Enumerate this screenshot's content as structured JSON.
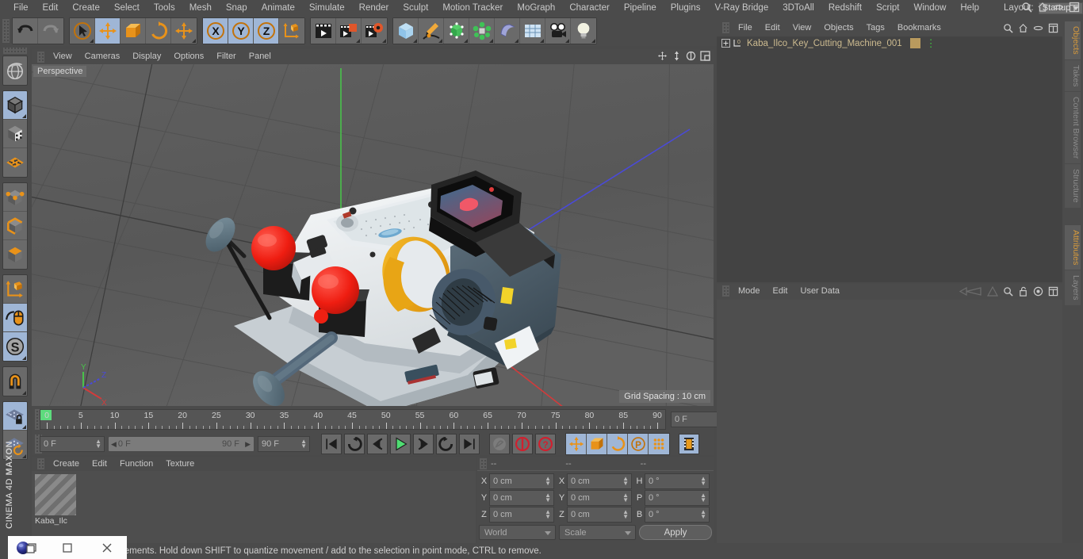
{
  "app": {
    "brand_top": "MAXON",
    "brand_bottom": "CINEMA 4D"
  },
  "menubar": {
    "items": [
      "File",
      "Edit",
      "Create",
      "Select",
      "Tools",
      "Mesh",
      "Snap",
      "Animate",
      "Simulate",
      "Render",
      "Sculpt",
      "Motion Tracker",
      "MoGraph",
      "Character",
      "Pipeline",
      "Plugins",
      "V-Ray Bridge",
      "3DToAll",
      "Redshift",
      "Script",
      "Window",
      "Help"
    ],
    "layout_label": "Layout:",
    "layout_value": "Startup",
    "icons": [
      "search-icon",
      "home-icon",
      "minimize-icon",
      "maximize-icon"
    ]
  },
  "toolbar": {
    "groups": [
      {
        "name": "history",
        "buttons": [
          {
            "icon": "undo-icon",
            "selected": false,
            "corner": false
          },
          {
            "icon": "redo-icon",
            "selected": false,
            "corner": false
          }
        ]
      },
      {
        "name": "tools",
        "buttons": [
          {
            "icon": "live-selection-icon",
            "selected": false,
            "corner": true
          },
          {
            "icon": "move-icon",
            "selected": true,
            "corner": false
          },
          {
            "icon": "scale-icon",
            "selected": false,
            "corner": false
          },
          {
            "icon": "rotate-icon",
            "selected": false,
            "corner": false
          },
          {
            "icon": "move-dup-icon",
            "selected": false,
            "corner": true
          }
        ]
      },
      {
        "name": "axis-locks",
        "buttons": [
          {
            "icon": "axis-x-icon",
            "selected": true,
            "corner": false
          },
          {
            "icon": "axis-y-icon",
            "selected": true,
            "corner": false
          },
          {
            "icon": "axis-z-icon",
            "selected": true,
            "corner": false
          },
          {
            "icon": "world-coordinate-icon",
            "selected": false,
            "corner": false
          }
        ]
      },
      {
        "name": "render",
        "buttons": [
          {
            "icon": "render-view-icon",
            "selected": false,
            "corner": false
          },
          {
            "icon": "render-region-icon",
            "selected": false,
            "corner": true
          },
          {
            "icon": "render-settings-icon",
            "selected": false,
            "corner": true
          }
        ]
      },
      {
        "name": "primitives",
        "buttons": [
          {
            "icon": "cube-primitive-icon",
            "selected": false,
            "corner": true
          },
          {
            "icon": "spline-pen-icon",
            "selected": false,
            "corner": true
          },
          {
            "icon": "array-generator-icon",
            "selected": false,
            "corner": true
          },
          {
            "icon": "mograph-cloner-icon",
            "selected": false,
            "corner": true
          },
          {
            "icon": "bend-deformer-icon",
            "selected": false,
            "corner": true
          },
          {
            "icon": "floor-environment-icon",
            "selected": false,
            "corner": true
          },
          {
            "icon": "camera-icon",
            "selected": false,
            "corner": true
          },
          {
            "icon": "light-icon",
            "selected": false,
            "corner": true
          }
        ]
      }
    ]
  },
  "leftbar": {
    "groups": [
      {
        "buttons": [
          {
            "icon": "undo-view-globe-icon",
            "selected": false,
            "corner": false
          }
        ]
      },
      {
        "buttons": [
          {
            "icon": "make-editable-cube-icon",
            "selected": true,
            "corner": true
          },
          {
            "icon": "texture-axis-icon",
            "selected": false,
            "corner": false
          },
          {
            "icon": "grid-plane-icon",
            "selected": false,
            "corner": false
          }
        ]
      },
      {
        "buttons": [
          {
            "icon": "point-mode-icon",
            "selected": false,
            "corner": false
          },
          {
            "icon": "edge-mode-icon",
            "selected": false,
            "corner": false
          },
          {
            "icon": "polygon-mode-icon",
            "selected": false,
            "corner": false
          }
        ]
      },
      {
        "buttons": [
          {
            "icon": "object-axis-icon",
            "selected": false,
            "corner": false
          },
          {
            "icon": "mouse-viewport-icon",
            "selected": true,
            "corner": false
          },
          {
            "icon": "soft-selection-icon",
            "selected": true,
            "corner": true
          }
        ]
      },
      {
        "buttons": [
          {
            "icon": "magnet-icon",
            "selected": false,
            "corner": true
          }
        ]
      },
      {
        "buttons": [
          {
            "icon": "workplane-lock-icon",
            "selected": true,
            "corner": true
          },
          {
            "icon": "workplane-rotate-icon",
            "selected": false,
            "corner": true
          }
        ]
      }
    ]
  },
  "viewport": {
    "menu": [
      "View",
      "Cameras",
      "Display",
      "Options",
      "Filter",
      "Panel"
    ],
    "corner_icons": [
      "pan-icon",
      "dolly-icon",
      "rotate-view-icon",
      "maximize-view-icon"
    ],
    "camera_label": "Perspective",
    "grid_spacing": "Grid Spacing : 10 cm",
    "axis_gizmo": {
      "x": "X",
      "y": "Y",
      "z": "Z",
      "x_color": "#e04a4a",
      "y_color": "#4ae04a",
      "z_color": "#4a6ae0"
    },
    "scene": {
      "object_name": "Kaba_Ilco Key Cutting Machine",
      "body_color": "#eef1f3",
      "dark_part_color": "#4f606c",
      "knob_color": "#f01f12",
      "wheel_color": "#e9a210",
      "screen_color": "#1a1a1a",
      "handle_color": "#5e7480",
      "accent_yellow": "#f2d32a",
      "background_color": "#585858"
    }
  },
  "timeline": {
    "ticks": [
      "0",
      "5",
      "10",
      "15",
      "20",
      "25",
      "30",
      "35",
      "40",
      "45",
      "50",
      "55",
      "60",
      "65",
      "70",
      "75",
      "80",
      "85",
      "90"
    ],
    "current_frame": "0 F",
    "range_start": "0 F",
    "range_end": "90 F",
    "preview_end": "90 F",
    "end_field": "0 F",
    "transport": [
      {
        "icon": "goto-start-icon",
        "selected": false
      },
      {
        "icon": "previous-key-icon",
        "selected": false
      },
      {
        "icon": "step-back-icon",
        "selected": false
      },
      {
        "icon": "play-icon",
        "selected": false
      },
      {
        "icon": "step-forward-icon",
        "selected": false
      },
      {
        "icon": "next-key-icon",
        "selected": false
      },
      {
        "icon": "goto-end-icon",
        "selected": false
      }
    ],
    "record_group": [
      {
        "icon": "autokey-icon",
        "selected": false
      },
      {
        "icon": "record-keyframe-icon",
        "selected": false
      },
      {
        "icon": "keyframe-selection-icon",
        "selected": false
      }
    ],
    "param_group": [
      {
        "icon": "record-position-icon",
        "selected": true
      },
      {
        "icon": "record-scale-icon",
        "selected": true
      },
      {
        "icon": "record-rotation-icon",
        "selected": true
      },
      {
        "icon": "record-pla-icon",
        "selected": true
      },
      {
        "icon": "record-param-icon",
        "selected": true
      }
    ],
    "film_button": {
      "icon": "timeline-filmstrip-icon",
      "selected": true
    }
  },
  "material_manager": {
    "menu": [
      "Create",
      "Edit",
      "Function",
      "Texture"
    ],
    "materials": [
      {
        "name": "Kaba_Ilc"
      }
    ]
  },
  "coordinates": {
    "headers": [
      "--",
      "--",
      "--"
    ],
    "rows": [
      {
        "label1": "X",
        "value1": "0 cm",
        "label2": "X",
        "value2": "0 cm",
        "label3": "H",
        "value3": "0 °"
      },
      {
        "label1": "Y",
        "value1": "0 cm",
        "label2": "Y",
        "value2": "0 cm",
        "label3": "P",
        "value3": "0 °"
      },
      {
        "label1": "Z",
        "value1": "0 cm",
        "label2": "Z",
        "value2": "0 cm",
        "label3": "B",
        "value3": "0 °"
      }
    ],
    "space_dropdown": "World",
    "mode_dropdown": "Scale",
    "apply_label": "Apply"
  },
  "object_manager": {
    "menu": [
      "File",
      "Edit",
      "View",
      "Objects",
      "Tags",
      "Bookmarks"
    ],
    "icons": [
      "search-icon",
      "home-icon",
      "minimize-icon",
      "maximize-icon"
    ],
    "objects": [
      {
        "name": "Kaba_Ilco_Key_Cutting_Machine_001",
        "tag_color": "#b99a5e",
        "dots": "green"
      }
    ]
  },
  "attribute_manager": {
    "menu": [
      "Mode",
      "Edit",
      "User Data"
    ],
    "icons": [
      "back-nav-icon",
      "forward-nav-icon",
      "search-icon",
      "lock-icon",
      "target-icon",
      "maximize-icon"
    ]
  },
  "right_tabs": {
    "top": [
      {
        "label": "Objects",
        "active": true
      },
      {
        "label": "Takes",
        "active": false
      },
      {
        "label": "Content Browser",
        "active": false
      },
      {
        "label": "Structure",
        "active": false
      }
    ],
    "bottom": [
      {
        "label": "Attributes",
        "active": true
      },
      {
        "label": "Layers",
        "active": false
      }
    ]
  },
  "status_bar": {
    "text": "Click and drag to move elements. Hold down SHIFT to quantize movement / add to the selection in point mode, CTRL to remove."
  },
  "window_chrome": {
    "buttons": [
      "restore-icon",
      "maximize-icon",
      "close-icon"
    ]
  }
}
